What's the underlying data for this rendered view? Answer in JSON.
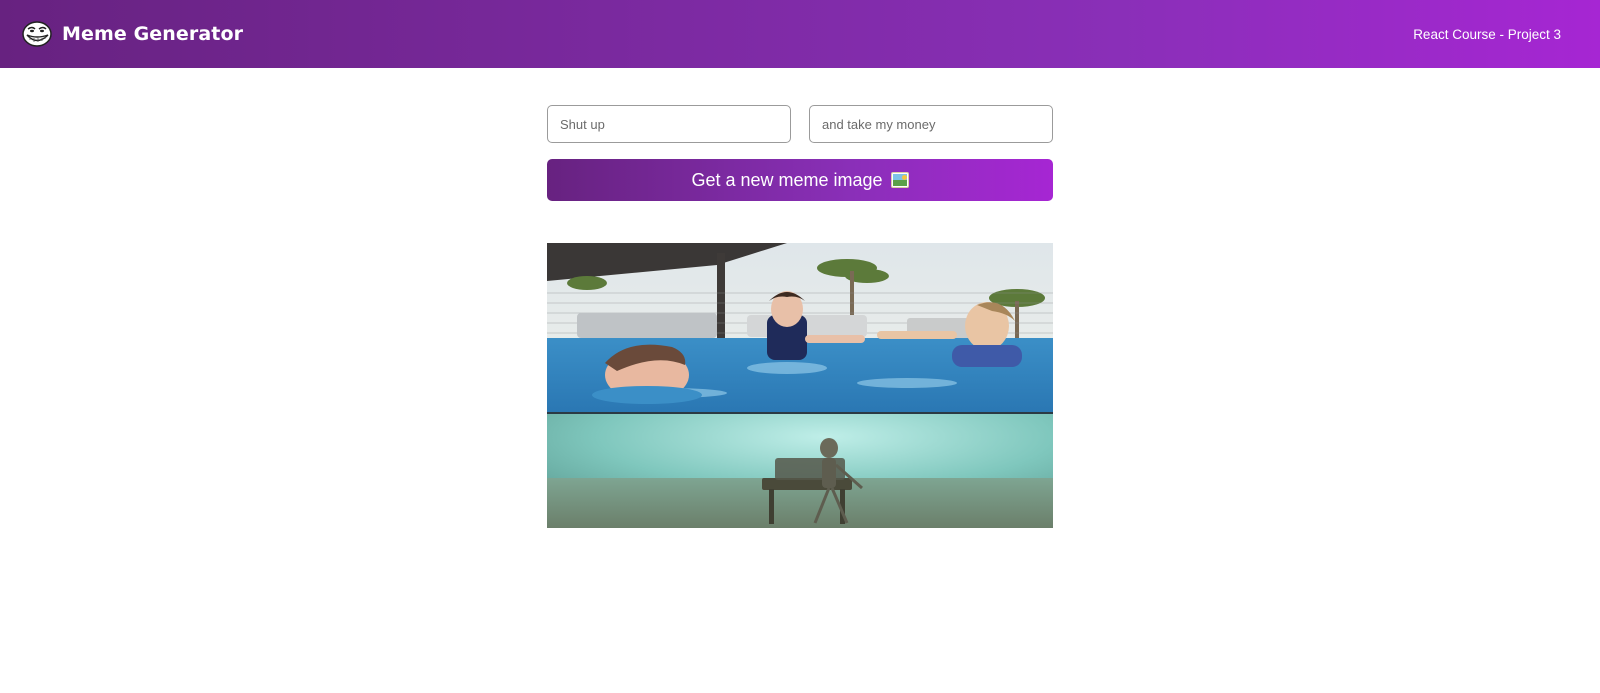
{
  "header": {
    "logo_icon": "troll-face-icon",
    "title": "Meme Generator",
    "project": "React Course - Project 3"
  },
  "form": {
    "top_text": {
      "value": "",
      "placeholder": "Shut up"
    },
    "bottom_text": {
      "value": "",
      "placeholder": "and take my money"
    },
    "button_label": "Get a new meme image",
    "button_icon": "framed-picture-icon"
  },
  "meme": {
    "image": "drowning-kid-skeleton-meme-image",
    "alt": "Meme image"
  },
  "colors": {
    "gradient_start": "#672280",
    "gradient_end": "#a626d3"
  }
}
